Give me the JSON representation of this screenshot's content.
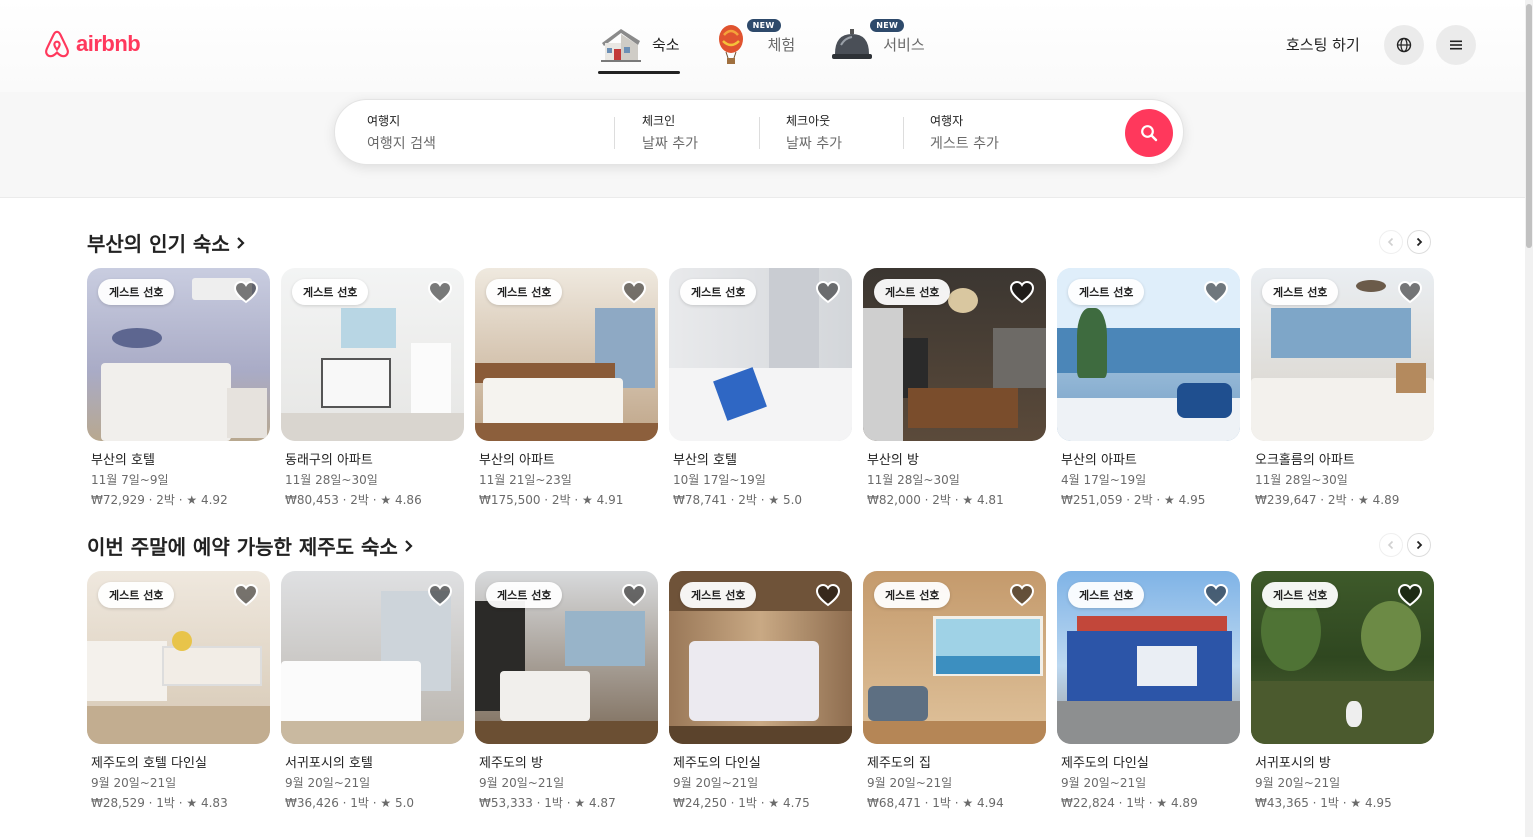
{
  "brand": {
    "name": "airbnb",
    "color": "#ff385c"
  },
  "nav": {
    "items": [
      {
        "label": "숙소",
        "icon": "house-icon",
        "badge": "",
        "active": true
      },
      {
        "label": "체험",
        "icon": "hot-air-balloon-icon",
        "badge": "NEW",
        "active": false
      },
      {
        "label": "서비스",
        "icon": "service-bell-icon",
        "badge": "NEW",
        "active": false
      }
    ],
    "host_label": "호스팅 하기"
  },
  "search": {
    "where": {
      "title": "여행지",
      "placeholder": "여행지 검색"
    },
    "checkin": {
      "title": "체크인",
      "placeholder": "날짜 추가"
    },
    "checkout": {
      "title": "체크아웃",
      "placeholder": "날짜 추가"
    },
    "guests": {
      "title": "여행자",
      "placeholder": "게스트 추가"
    }
  },
  "sections": [
    {
      "title": "부산의 인기 숙소",
      "listings": [
        {
          "title": "부산의 호텔",
          "dates": "11월 7일~9일",
          "meta": "₩72,929 · 2박 · ★ 4.92",
          "badge": "게스트 선호"
        },
        {
          "title": "동래구의 아파트",
          "dates": "11월 28일~30일",
          "meta": "₩80,453 · 2박 · ★ 4.86",
          "badge": "게스트 선호"
        },
        {
          "title": "부산의 아파트",
          "dates": "11월 21일~23일",
          "meta": "₩175,500 · 2박 · ★ 4.91",
          "badge": "게스트 선호"
        },
        {
          "title": "부산의 호텔",
          "dates": "10월 17일~19일",
          "meta": "₩78,741 · 2박 · ★ 5.0",
          "badge": "게스트 선호"
        },
        {
          "title": "부산의 방",
          "dates": "11월 28일~30일",
          "meta": "₩82,000 · 2박 · ★ 4.81",
          "badge": "게스트 선호"
        },
        {
          "title": "부산의 아파트",
          "dates": "4월 17일~19일",
          "meta": "₩251,059 · 2박 · ★ 4.95",
          "badge": "게스트 선호"
        },
        {
          "title": "오크홀름의 아파트",
          "dates": "11월 28일~30일",
          "meta": "₩239,647 · 2박 · ★ 4.89",
          "badge": "게스트 선호"
        }
      ]
    },
    {
      "title": "이번 주말에 예약 가능한 제주도 숙소",
      "listings": [
        {
          "title": "제주도의 호텔 다인실",
          "dates": "9월 20일~21일",
          "meta": "₩28,529 · 1박 · ★ 4.83",
          "badge": "게스트 선호"
        },
        {
          "title": "서귀포시의 호텔",
          "dates": "9월 20일~21일",
          "meta": "₩36,426 · 1박 · ★ 5.0",
          "badge": ""
        },
        {
          "title": "제주도의 방",
          "dates": "9월 20일~21일",
          "meta": "₩53,333 · 1박 · ★ 4.87",
          "badge": "게스트 선호"
        },
        {
          "title": "제주도의 다인실",
          "dates": "9월 20일~21일",
          "meta": "₩24,250 · 1박 · ★ 4.75",
          "badge": "게스트 선호"
        },
        {
          "title": "제주도의 집",
          "dates": "9월 20일~21일",
          "meta": "₩68,471 · 1박 · ★ 4.94",
          "badge": "게스트 선호"
        },
        {
          "title": "제주도의 다인실",
          "dates": "9월 20일~21일",
          "meta": "₩22,824 · 1박 · ★ 4.89",
          "badge": "게스트 선호"
        },
        {
          "title": "서귀포시의 방",
          "dates": "9월 20일~21일",
          "meta": "₩43,365 · 1박 · ★ 4.95",
          "badge": "게스트 선호"
        }
      ]
    }
  ]
}
